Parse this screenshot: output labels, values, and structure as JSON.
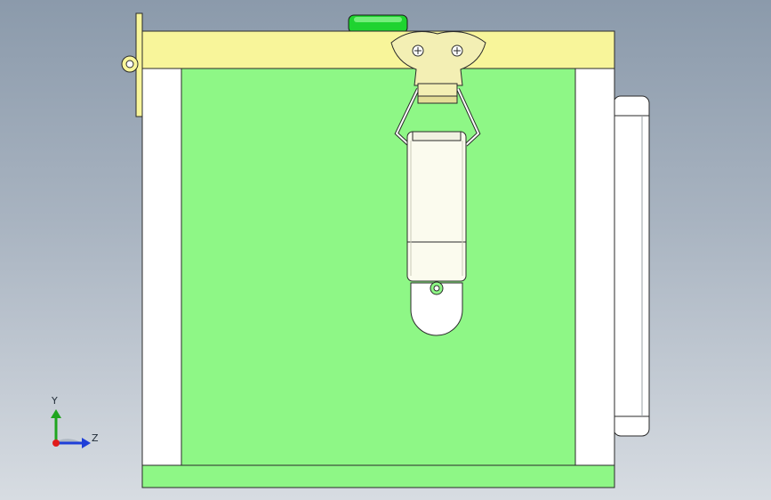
{
  "viewport": {
    "background_top": "#8b9aab",
    "background_bottom": "#d7dce2"
  },
  "colors": {
    "top_panel": "#f8f59a",
    "bottom_panel": "#8ef786",
    "front_panel": "#8ef786",
    "side_panel": "#ffffff",
    "button": "#1fd330",
    "latch": "#f3efb4",
    "latch_body": "#fbfbee",
    "outline": "#2a2a2a"
  },
  "triad": {
    "y_label": "Y",
    "z_label": "Z",
    "y_color": "#1fa51f",
    "z_color": "#1f3fd8",
    "x_color": "#e01b1b"
  }
}
